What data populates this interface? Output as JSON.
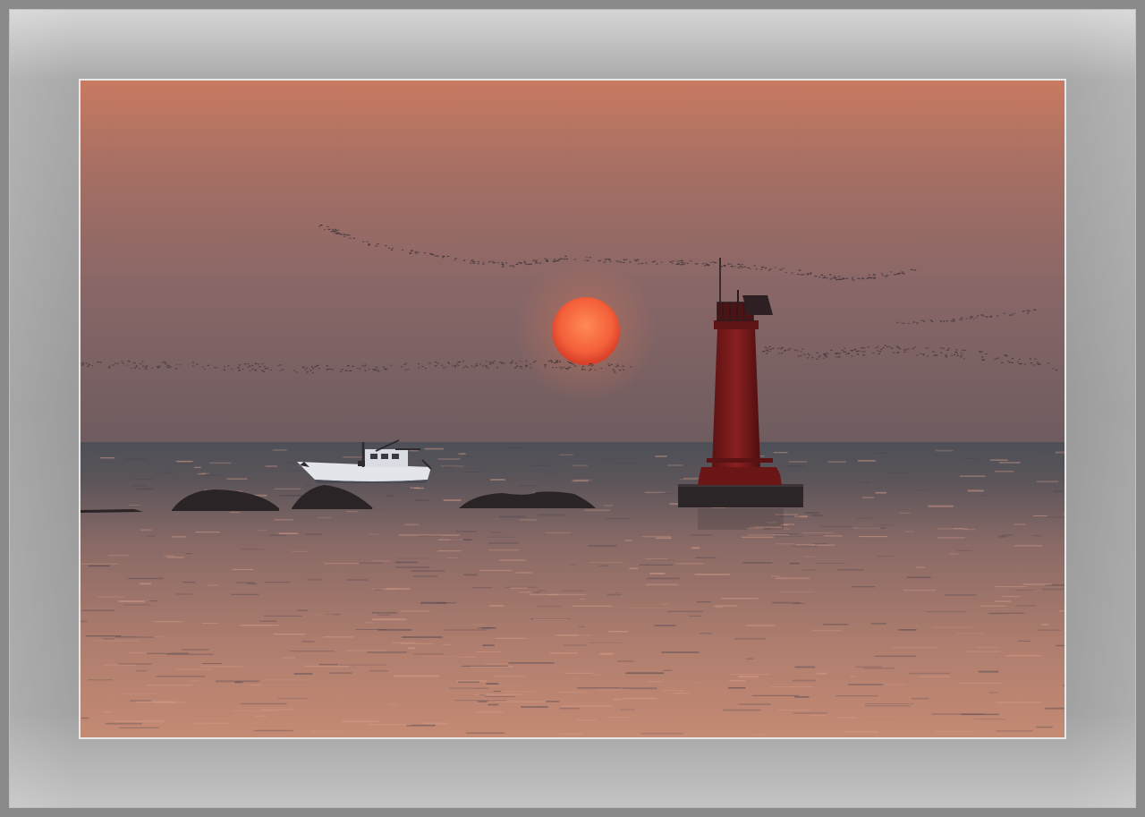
{
  "scene": {
    "subject": "sunset-over-sea-with-lighthouse",
    "colors": {
      "sky_top": "#c97a62",
      "sky_mid": "#8e6a68",
      "sky_horizon": "#6f5b5d",
      "sun_center": "#ff7a4a",
      "sun_edge": "#e0452c",
      "water_far": "#4f5158",
      "water_near": "#c08672",
      "lighthouse": "#7a1a1a",
      "silhouette": "#2a2426",
      "boat_hull": "#e6e6ea",
      "mat": "#9b9b9b",
      "outer_frame": "#8a8a8a"
    },
    "elements": [
      "sun",
      "red-lighthouse",
      "fishing-boat",
      "rocks",
      "flock-of-birds",
      "sea"
    ]
  }
}
